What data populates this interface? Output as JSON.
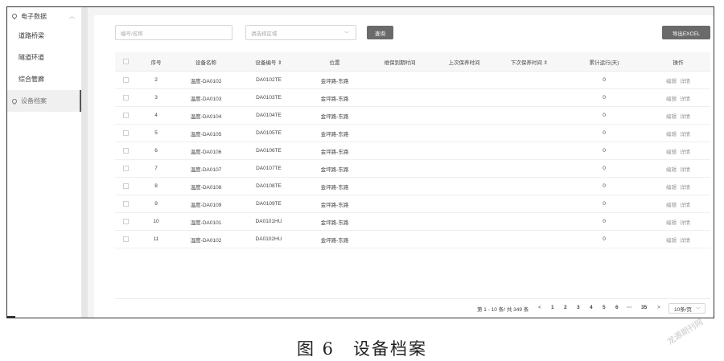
{
  "sidebar": {
    "group_label": "电子数据",
    "items": [
      "道路桥梁",
      "隧道环道",
      "综合管廊"
    ],
    "active_label": "设备档案"
  },
  "toolbar": {
    "code_placeholder": "编号/名称",
    "area_placeholder": "请选择区域",
    "query_label": "查询",
    "export_label": "导出EXCEL"
  },
  "table": {
    "headers": [
      "序号",
      "设备名称",
      "设备编号 ⇕",
      "位置",
      "维保到期时间",
      "上次保养时间",
      "下次保养时间 ⇕",
      "累计运行(天)",
      "操作"
    ],
    "rows": [
      [
        "2",
        "温度-DA0102",
        "DA0102TE",
        "金坪路-东路",
        "",
        "",
        "",
        "0"
      ],
      [
        "3",
        "温度-DA0103",
        "DA0103TE",
        "金坪路-东路",
        "",
        "",
        "",
        "0"
      ],
      [
        "4",
        "温度-DA0104",
        "DA0104TE",
        "金坪路-东路",
        "",
        "",
        "",
        "0"
      ],
      [
        "5",
        "温度-DA0105",
        "DA0105TE",
        "金坪路-东路",
        "",
        "",
        "",
        "0"
      ],
      [
        "6",
        "温度-DA0106",
        "DA0106TE",
        "金坪路-东路",
        "",
        "",
        "",
        "0"
      ],
      [
        "7",
        "温度-DA0107",
        "DA0107TE",
        "金坪路-东路",
        "",
        "",
        "",
        "0"
      ],
      [
        "8",
        "温度-DA0108",
        "DA0108TE",
        "金坪路-东路",
        "",
        "",
        "",
        "0"
      ],
      [
        "9",
        "温度-DA0109",
        "DA0109TE",
        "金坪路-东路",
        "",
        "",
        "",
        "0"
      ],
      [
        "10",
        "湿度-DA0101",
        "DA0101HU",
        "金坪路-东路",
        "",
        "",
        "",
        "0"
      ],
      [
        "11",
        "湿度-DA0102",
        "DA0102HU",
        "金坪路-东路",
        "",
        "",
        "",
        "0"
      ]
    ],
    "edit_label": "编辑",
    "detail_label": "详情"
  },
  "pager": {
    "total_text": "第 1 - 10 条/ 共 349 条",
    "prev": "<",
    "pages": [
      "1",
      "2",
      "3",
      "4",
      "5",
      "6"
    ],
    "ellipsis": "···",
    "last_page": "35",
    "next": ">",
    "page_size": "10条/页"
  },
  "caption": "图 6　设备档案",
  "watermark": "龙源期刊网"
}
